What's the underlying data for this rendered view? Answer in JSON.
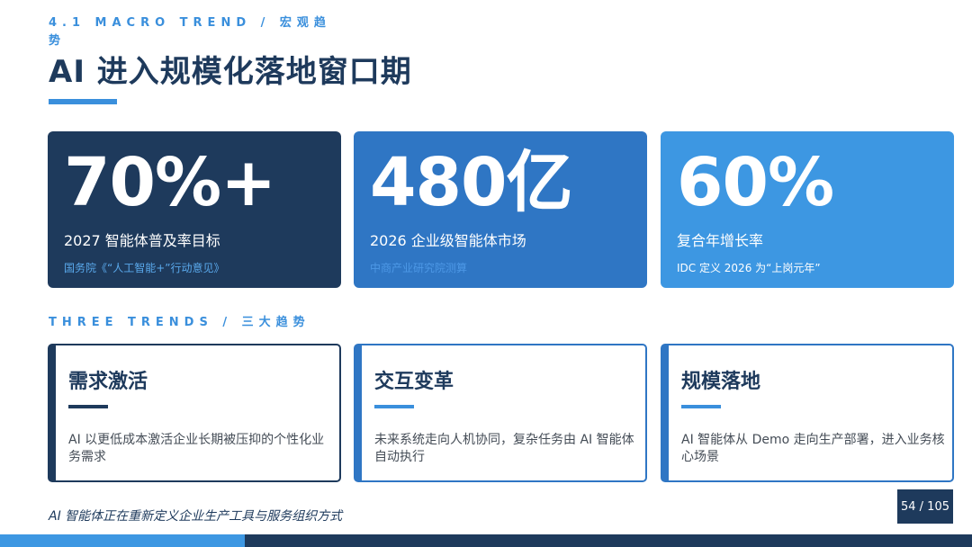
{
  "header": {
    "eyebrow": "4.1 MACRO TREND / 宏观趋势",
    "title": "AI 进入规模化落地窗口期"
  },
  "stats": [
    {
      "value": "70%+",
      "label": "2027 智能体普及率目标",
      "source": "国务院《“人工智能+”行动意见》"
    },
    {
      "value": "480亿",
      "label": "2026 企业级智能体市场",
      "source": "中商产业研究院测算"
    },
    {
      "value": "60%",
      "label": "复合年增长率",
      "source": "IDC 定义 2026 为“上岗元年”"
    }
  ],
  "trends_section": {
    "heading": "THREE TRENDS / 三大趋势"
  },
  "trends": [
    {
      "title": "需求激活",
      "text": "AI 以更低成本激活企业长期被压抑的个性化业务需求"
    },
    {
      "title": "交互变革",
      "text": "未来系统走向人机协同，复杂任务由 AI 智能体自动执行"
    },
    {
      "title": "规模落地",
      "text": "AI 智能体从 Demo 走向生产部署，进入业务核心场景"
    }
  ],
  "footer": {
    "note": "AI 智能体正在重新定义企业生产工具与服务组织方式",
    "page": "54 / 105"
  },
  "colors": {
    "navy": "#1e3a5c",
    "blue": "#2f76c4",
    "light_blue": "#3d97e2",
    "accent": "#3a8fdc"
  }
}
